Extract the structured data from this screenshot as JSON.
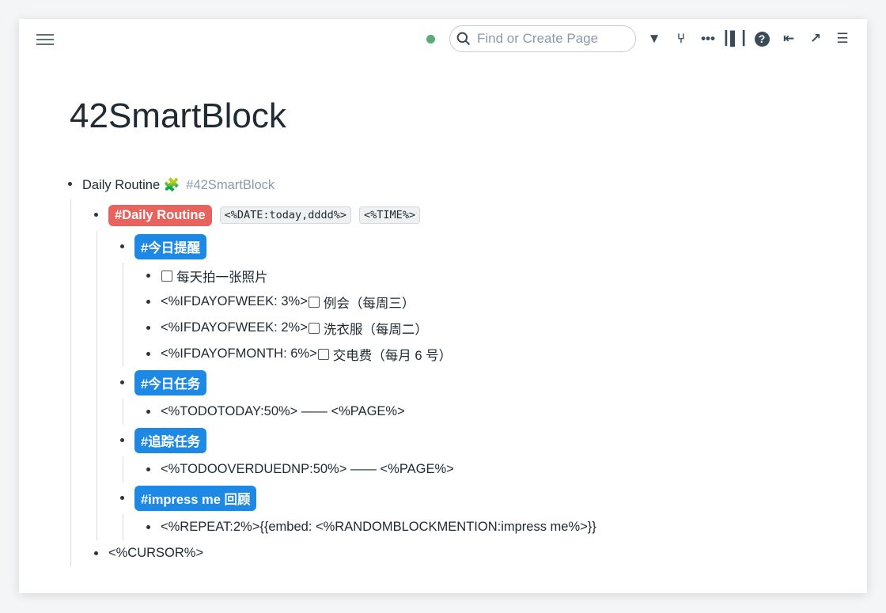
{
  "header": {
    "search_placeholder": "Find or Create Page",
    "status_color": "#5aaa7a",
    "icons": [
      "filter-icon",
      "graph-icon",
      "more-icon",
      "sidebar-icon",
      "help-icon",
      "outdent-icon",
      "connect-icon",
      "align-icon"
    ]
  },
  "page": {
    "title": "42SmartBlock"
  },
  "blocks": {
    "root": {
      "text": "Daily Routine",
      "emoji": "🧩",
      "tag": "#42SmartBlock"
    },
    "routine": {
      "tag": "#Daily Routine",
      "code1": "<%DATE:today,dddd%>",
      "code2": "<%TIME%>"
    },
    "reminder": {
      "tag": "#今日提醒",
      "items": [
        "每天拍一张照片",
        "<%IFDAYOFWEEK: 3%>",
        "例会（每周三）",
        "<%IFDAYOFWEEK: 2%>",
        "洗衣服（每周二）",
        "<%IFDAYOFMONTH: 6%>",
        "交电费（每月 6 号）"
      ]
    },
    "today": {
      "tag": "#今日任务",
      "item": "<%TODOTODAY:50%> —— <%PAGE%>"
    },
    "track": {
      "tag": "#追踪任务",
      "item": "<%TODOOVERDUEDNP:50%> —— <%PAGE%>"
    },
    "impress": {
      "tag": "#impress me 回顾",
      "item": "<%REPEAT:2%>{{embed: <%RANDOMBLOCKMENTION:impress me%>}}"
    },
    "cursor": "<%CURSOR%>"
  },
  "colors": {
    "red_tag": "#e8625e",
    "blue_tag": "#1e88e5"
  }
}
